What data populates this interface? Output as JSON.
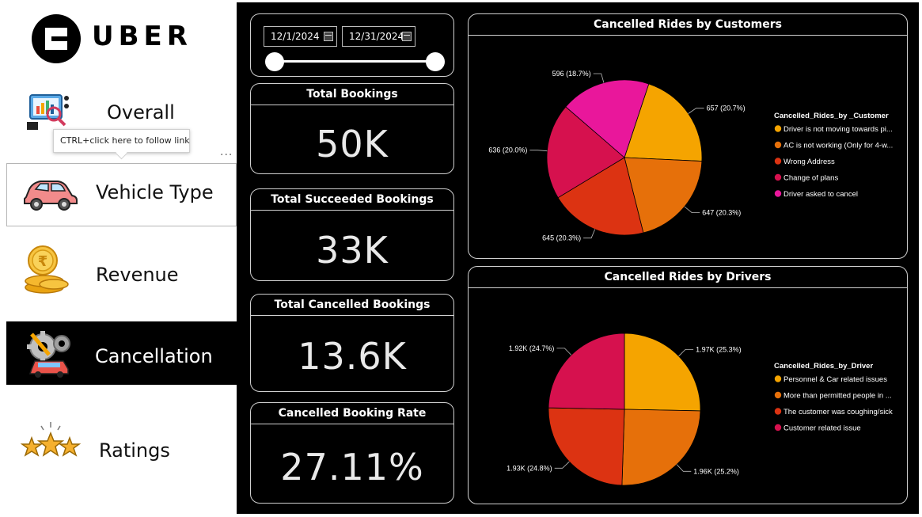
{
  "brand": {
    "name": "UBER"
  },
  "tooltip": {
    "text": "CTRL+click here to follow link",
    "more": "..."
  },
  "nav": {
    "overall": "Overall",
    "vehicle_type": "Vehicle Type",
    "revenue": "Revenue",
    "cancellation": "Cancellation",
    "ratings": "Ratings"
  },
  "filters": {
    "start_date": "12/1/2024",
    "end_date": "12/31/2024"
  },
  "kpis": {
    "total_bookings": {
      "label": "Total Bookings",
      "value": "50K"
    },
    "succeeded": {
      "label": "Total Succeeded Bookings",
      "value": "33K"
    },
    "cancelled": {
      "label": "Total Cancelled Bookings",
      "value": "13.6K"
    },
    "rate": {
      "label": "Cancelled Booking Rate",
      "value": "27.11%"
    }
  },
  "colors": {
    "orange": "#f5a400",
    "dark_orange": "#e6700a",
    "red_orange": "#dc3312",
    "crimson": "#d6114e",
    "magenta": "#e9179b"
  },
  "chart_data": [
    {
      "type": "pie",
      "title": "Cancelled Rides by Customers",
      "legend_title": "Cancelled_Rides_by _Customer",
      "legend_position": "right",
      "slices": [
        {
          "name": "Driver is not moving towards pi...",
          "value": 657,
          "label": "657 (20.7%)",
          "color": "#f5a400"
        },
        {
          "name": "AC is not working (Only for 4-w...",
          "value": 647,
          "label": "647 (20.3%)",
          "color": "#e6700a"
        },
        {
          "name": "Wrong Address",
          "value": 645,
          "label": "645 (20.3%)",
          "color": "#dc3312"
        },
        {
          "name": "Change of plans",
          "value": 636,
          "label": "636 (20.0%)",
          "color": "#d6114e"
        },
        {
          "name": "Driver asked to cancel",
          "value": 596,
          "label": "596 (18.7%)",
          "color": "#e9179b"
        }
      ]
    },
    {
      "type": "pie",
      "title": "Cancelled Rides by Drivers",
      "legend_title": "Cancelled_Rides_by_Driver",
      "legend_position": "right",
      "slices": [
        {
          "name": "Personnel & Car related issues",
          "value": 1970,
          "label": "1.97K (25.3%)",
          "color": "#f5a400"
        },
        {
          "name": "More than permitted people in ...",
          "value": 1960,
          "label": "1.96K (25.2%)",
          "color": "#e6700a"
        },
        {
          "name": "The customer was coughing/sick",
          "value": 1930,
          "label": "1.93K (24.8%)",
          "color": "#dc3312"
        },
        {
          "name": "Customer related issue",
          "value": 1920,
          "label": "1.92K (24.7%)",
          "color": "#d6114e"
        }
      ]
    }
  ]
}
